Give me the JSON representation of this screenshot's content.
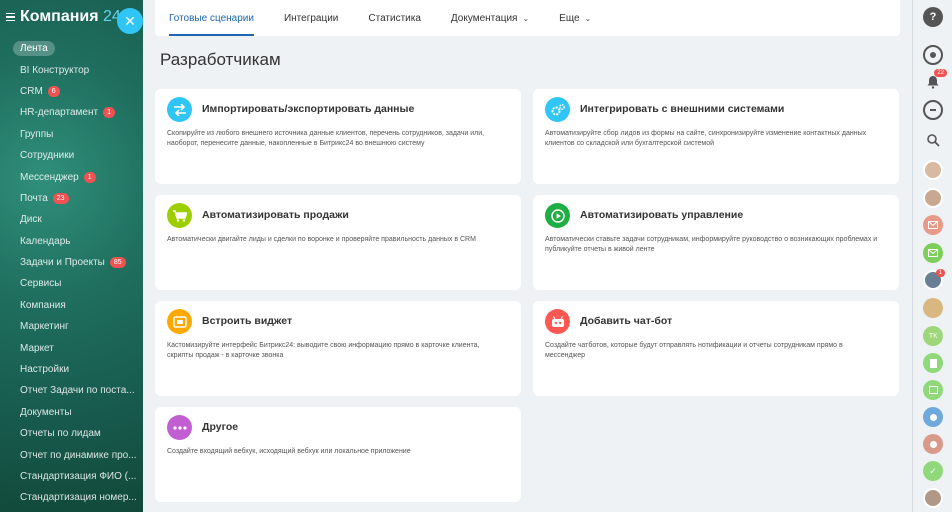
{
  "sidebar": {
    "logo_name": "Компания",
    "logo_num": "24",
    "items": [
      {
        "label": "Лента",
        "badge": ""
      },
      {
        "label": "BI Конструктор",
        "badge": ""
      },
      {
        "label": "CRM",
        "badge": "6"
      },
      {
        "label": "HR-департамент",
        "badge": "1"
      },
      {
        "label": "Группы",
        "badge": ""
      },
      {
        "label": "Сотрудники",
        "badge": ""
      },
      {
        "label": "Мессенджер",
        "badge": "1"
      },
      {
        "label": "Почта",
        "badge": "23"
      },
      {
        "label": "Диск",
        "badge": ""
      },
      {
        "label": "Календарь",
        "badge": ""
      },
      {
        "label": "Задачи и Проекты",
        "badge": "85"
      },
      {
        "label": "Сервисы",
        "badge": ""
      },
      {
        "label": "Компания",
        "badge": ""
      },
      {
        "label": "Маркетинг",
        "badge": ""
      },
      {
        "label": "Маркет",
        "badge": ""
      },
      {
        "label": "Настройки",
        "badge": ""
      },
      {
        "label": "Отчет Задачи по поста...",
        "badge": ""
      },
      {
        "label": "Документы",
        "badge": ""
      },
      {
        "label": "Отчеты по лидам",
        "badge": ""
      },
      {
        "label": "Отчет по динамике про...",
        "badge": ""
      },
      {
        "label": "Стандартизация ФИО (...",
        "badge": ""
      },
      {
        "label": "Стандартизация номер...",
        "badge": ""
      }
    ]
  },
  "tabs": [
    {
      "label": "Готовые сценарии"
    },
    {
      "label": "Интеграции"
    },
    {
      "label": "Статистика"
    },
    {
      "label": "Документация"
    },
    {
      "label": "Еще"
    }
  ],
  "page_title": "Разработчикам",
  "cards": [
    {
      "title": "Импортировать/экспортировать данные",
      "desc": "Скопируйте из любого внешнего источника данные клиентов, перечень сотрудников, задачи или, наоборот, перенесите данные, накопленные в Битрикс24 во внешнюю систему",
      "icon": "arrows-swap-icon",
      "color": "#2fc6f6"
    },
    {
      "title": "Интегрировать с внешними системами",
      "desc": "Автоматизируйте сбор лидов из формы на сайте, синхронизируйте изменение контактных данных клиентов со складской или бухгалтерской системой",
      "icon": "gears-icon",
      "color": "#2fc6f6"
    },
    {
      "title": "Автоматизировать продажи",
      "desc": "Автоматически двигайте лиды и сделки по воронке и проверяйте правильность данных в CRM",
      "icon": "cart-icon",
      "color": "#9dcf00"
    },
    {
      "title": "Автоматизировать управление",
      "desc": "Автоматически ставьте задачи сотрудникам, информируйте руководство о возникающих проблемах и публикуйте отчеты в живой ленте",
      "icon": "play-icon",
      "color": "#1eae43"
    },
    {
      "title": "Встроить виджет",
      "desc": "Кастомизируйте интерфейс Битрикс24: выводите свою информацию прямо в карточке клиента, скрипты продаж - в карточке звонка",
      "icon": "widget-icon",
      "color": "#ffa900"
    },
    {
      "title": "Добавить чат-бот",
      "desc": "Создайте чатботов, которые будут отправлять нотификации и отчеты сотрудникам прямо в мессенджер",
      "icon": "bot-icon",
      "color": "#ff5752"
    },
    {
      "title": "Другое",
      "desc": "Создайте входящий вебхук, исходящий вебхук или локальное приложение",
      "icon": "dots-icon",
      "color": "#c15fd2"
    }
  ],
  "rightbar": {
    "notif_badge": "22",
    "chat_badge": "1"
  }
}
